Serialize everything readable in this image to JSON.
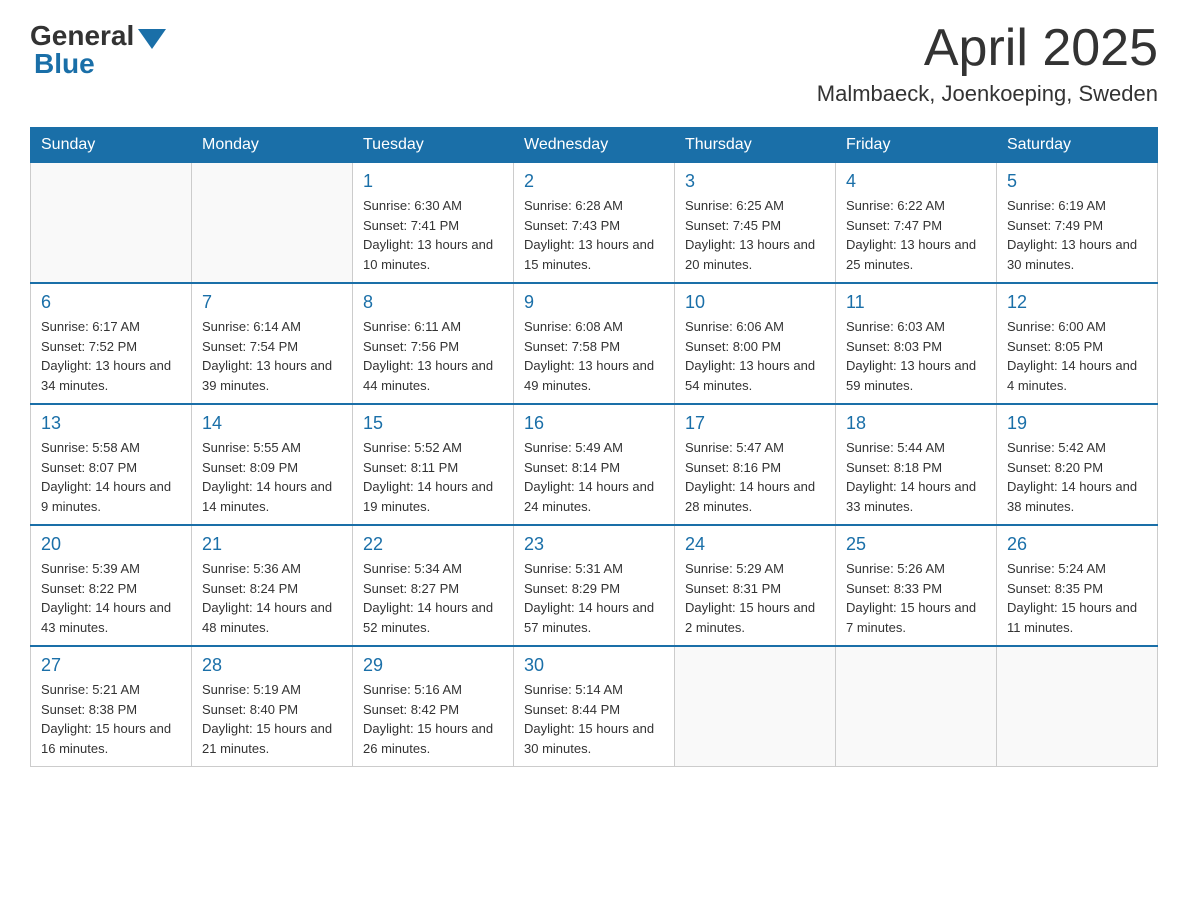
{
  "header": {
    "logo_general": "General",
    "logo_blue": "Blue",
    "month_year": "April 2025",
    "location": "Malmbaeck, Joenkoeping, Sweden"
  },
  "weekdays": [
    "Sunday",
    "Monday",
    "Tuesday",
    "Wednesday",
    "Thursday",
    "Friday",
    "Saturday"
  ],
  "weeks": [
    {
      "days": [
        {
          "empty": true
        },
        {
          "empty": true
        },
        {
          "num": "1",
          "sunrise": "Sunrise: 6:30 AM",
          "sunset": "Sunset: 7:41 PM",
          "daylight": "Daylight: 13 hours and 10 minutes."
        },
        {
          "num": "2",
          "sunrise": "Sunrise: 6:28 AM",
          "sunset": "Sunset: 7:43 PM",
          "daylight": "Daylight: 13 hours and 15 minutes."
        },
        {
          "num": "3",
          "sunrise": "Sunrise: 6:25 AM",
          "sunset": "Sunset: 7:45 PM",
          "daylight": "Daylight: 13 hours and 20 minutes."
        },
        {
          "num": "4",
          "sunrise": "Sunrise: 6:22 AM",
          "sunset": "Sunset: 7:47 PM",
          "daylight": "Daylight: 13 hours and 25 minutes."
        },
        {
          "num": "5",
          "sunrise": "Sunrise: 6:19 AM",
          "sunset": "Sunset: 7:49 PM",
          "daylight": "Daylight: 13 hours and 30 minutes."
        }
      ]
    },
    {
      "days": [
        {
          "num": "6",
          "sunrise": "Sunrise: 6:17 AM",
          "sunset": "Sunset: 7:52 PM",
          "daylight": "Daylight: 13 hours and 34 minutes."
        },
        {
          "num": "7",
          "sunrise": "Sunrise: 6:14 AM",
          "sunset": "Sunset: 7:54 PM",
          "daylight": "Daylight: 13 hours and 39 minutes."
        },
        {
          "num": "8",
          "sunrise": "Sunrise: 6:11 AM",
          "sunset": "Sunset: 7:56 PM",
          "daylight": "Daylight: 13 hours and 44 minutes."
        },
        {
          "num": "9",
          "sunrise": "Sunrise: 6:08 AM",
          "sunset": "Sunset: 7:58 PM",
          "daylight": "Daylight: 13 hours and 49 minutes."
        },
        {
          "num": "10",
          "sunrise": "Sunrise: 6:06 AM",
          "sunset": "Sunset: 8:00 PM",
          "daylight": "Daylight: 13 hours and 54 minutes."
        },
        {
          "num": "11",
          "sunrise": "Sunrise: 6:03 AM",
          "sunset": "Sunset: 8:03 PM",
          "daylight": "Daylight: 13 hours and 59 minutes."
        },
        {
          "num": "12",
          "sunrise": "Sunrise: 6:00 AM",
          "sunset": "Sunset: 8:05 PM",
          "daylight": "Daylight: 14 hours and 4 minutes."
        }
      ]
    },
    {
      "days": [
        {
          "num": "13",
          "sunrise": "Sunrise: 5:58 AM",
          "sunset": "Sunset: 8:07 PM",
          "daylight": "Daylight: 14 hours and 9 minutes."
        },
        {
          "num": "14",
          "sunrise": "Sunrise: 5:55 AM",
          "sunset": "Sunset: 8:09 PM",
          "daylight": "Daylight: 14 hours and 14 minutes."
        },
        {
          "num": "15",
          "sunrise": "Sunrise: 5:52 AM",
          "sunset": "Sunset: 8:11 PM",
          "daylight": "Daylight: 14 hours and 19 minutes."
        },
        {
          "num": "16",
          "sunrise": "Sunrise: 5:49 AM",
          "sunset": "Sunset: 8:14 PM",
          "daylight": "Daylight: 14 hours and 24 minutes."
        },
        {
          "num": "17",
          "sunrise": "Sunrise: 5:47 AM",
          "sunset": "Sunset: 8:16 PM",
          "daylight": "Daylight: 14 hours and 28 minutes."
        },
        {
          "num": "18",
          "sunrise": "Sunrise: 5:44 AM",
          "sunset": "Sunset: 8:18 PM",
          "daylight": "Daylight: 14 hours and 33 minutes."
        },
        {
          "num": "19",
          "sunrise": "Sunrise: 5:42 AM",
          "sunset": "Sunset: 8:20 PM",
          "daylight": "Daylight: 14 hours and 38 minutes."
        }
      ]
    },
    {
      "days": [
        {
          "num": "20",
          "sunrise": "Sunrise: 5:39 AM",
          "sunset": "Sunset: 8:22 PM",
          "daylight": "Daylight: 14 hours and 43 minutes."
        },
        {
          "num": "21",
          "sunrise": "Sunrise: 5:36 AM",
          "sunset": "Sunset: 8:24 PM",
          "daylight": "Daylight: 14 hours and 48 minutes."
        },
        {
          "num": "22",
          "sunrise": "Sunrise: 5:34 AM",
          "sunset": "Sunset: 8:27 PM",
          "daylight": "Daylight: 14 hours and 52 minutes."
        },
        {
          "num": "23",
          "sunrise": "Sunrise: 5:31 AM",
          "sunset": "Sunset: 8:29 PM",
          "daylight": "Daylight: 14 hours and 57 minutes."
        },
        {
          "num": "24",
          "sunrise": "Sunrise: 5:29 AM",
          "sunset": "Sunset: 8:31 PM",
          "daylight": "Daylight: 15 hours and 2 minutes."
        },
        {
          "num": "25",
          "sunrise": "Sunrise: 5:26 AM",
          "sunset": "Sunset: 8:33 PM",
          "daylight": "Daylight: 15 hours and 7 minutes."
        },
        {
          "num": "26",
          "sunrise": "Sunrise: 5:24 AM",
          "sunset": "Sunset: 8:35 PM",
          "daylight": "Daylight: 15 hours and 11 minutes."
        }
      ]
    },
    {
      "days": [
        {
          "num": "27",
          "sunrise": "Sunrise: 5:21 AM",
          "sunset": "Sunset: 8:38 PM",
          "daylight": "Daylight: 15 hours and 16 minutes."
        },
        {
          "num": "28",
          "sunrise": "Sunrise: 5:19 AM",
          "sunset": "Sunset: 8:40 PM",
          "daylight": "Daylight: 15 hours and 21 minutes."
        },
        {
          "num": "29",
          "sunrise": "Sunrise: 5:16 AM",
          "sunset": "Sunset: 8:42 PM",
          "daylight": "Daylight: 15 hours and 26 minutes."
        },
        {
          "num": "30",
          "sunrise": "Sunrise: 5:14 AM",
          "sunset": "Sunset: 8:44 PM",
          "daylight": "Daylight: 15 hours and 30 minutes."
        },
        {
          "empty": true
        },
        {
          "empty": true
        },
        {
          "empty": true
        }
      ]
    }
  ]
}
